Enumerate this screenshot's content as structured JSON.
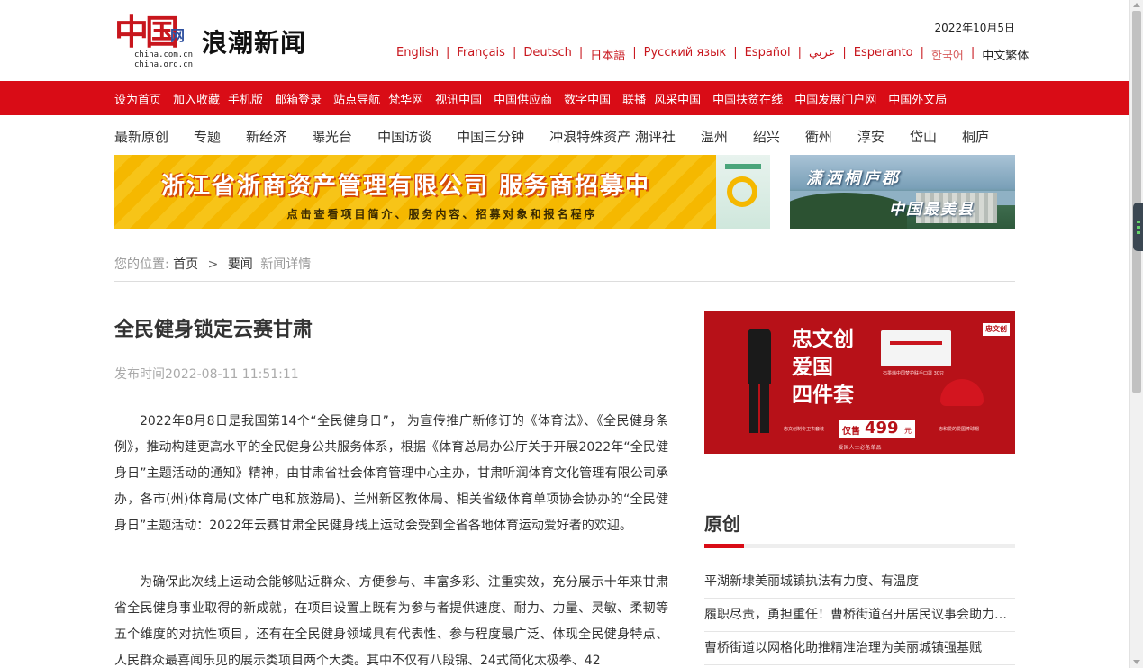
{
  "header": {
    "logo_cn": "中国",
    "logo_wang": "网",
    "logo_domain1": "china.com.cn",
    "logo_domain2": "china.org.cn",
    "site_name": "浪潮新闻",
    "date": "2022年10月5日",
    "languages": [
      "English",
      "Français",
      "Deutsch",
      "日本語",
      "Русский язык",
      "Español",
      "عربي",
      "Esperanto",
      "한국어",
      "中文繁体"
    ],
    "separator": "|"
  },
  "red_nav": [
    "设为首页",
    "加入收藏",
    "手机版",
    "邮箱登录",
    "站点导航",
    "梵华网",
    "视讯中国",
    "中国供应商",
    "数字中国",
    "联播",
    "风采中国",
    "中国扶贫在线",
    "中国发展门户网",
    "中国外文局"
  ],
  "sub_nav": [
    "最新原创",
    "专题",
    "新经济",
    "曝光台",
    "中国访谈",
    "中国三分钟",
    "冲浪特殊资产 潮评社",
    "温州",
    "绍兴",
    "衢州",
    "淳安",
    "岱山",
    "桐庐"
  ],
  "banners": {
    "banner1_title": "浙江省浙商资产管理有限公司 服务商招募中",
    "banner1_sub": "点击查看项目简介、服务内容、招募对象和报名程序",
    "banner2_line1": "潇洒桐庐郡",
    "banner2_line2": "中国最美县"
  },
  "breadcrumb": {
    "label": "您的位置:",
    "home": "首页",
    "sep": ">",
    "section": "要闻",
    "current": "新闻详情"
  },
  "article": {
    "title": "全民健身锁定云赛甘肃",
    "pubtime": "发布时间2022-08-11 11:51:11",
    "paragraphs": [
      "2022年8月8日是我国第14个“全民健身日”， 为宣传推广新修订的《体育法》、《全民健身条例》，推动构建更高水平的全民健身公共服务体系，根据《体育总局办公厅关于开展2022年“全民健身日”主题活动的通知》精神，由甘肃省社会体育管理中心主办，甘肃听润体育文化管理有限公司承办，各市(州)体育局(文体广电和旅游局)、兰州新区教体局、相关省级体育单项协会协办的“全民健身日”主题活动：2022年云赛甘肃全民健身线上运动会受到全省各地体育运动爱好者的欢迎。",
      "为确保此次线上运动会能够贴近群众、方便参与、丰富多彩、注重实效，充分展示十年来甘肃省全民健身事业取得的新成就，在项目设置上既有为参与者提供速度、耐力、力量、灵敏、柔韧等五个维度的对抗性项目，还有在全民健身领域具有代表性、参与程度最广泛、体现全民健身特点、人民群众最喜闻乐见的展示类项目两个大类。其中不仅有八段锦、24式简化太极拳、42"
    ]
  },
  "sidebar": {
    "ad": {
      "title": "忠文创\n爱国\n四件套",
      "logo": "忠文创",
      "price_label": "仅售",
      "price": "499",
      "price_unit": "元",
      "note1": "石墨烯中国梦护肤手口罩 30只",
      "note2": "忠文创制专卫衣套装",
      "note3": "忠和爱的爱国棒球帽",
      "footer": "爱国人士必备单品"
    },
    "section_title": "原创",
    "news": [
      "平湖新埭美丽城镇执法有力度、有温度",
      "履职尽责，勇担重任！曹桥街道召开居民议事会助力美丽城镇建设",
      "曹桥街道以网格化助推精准治理为美丽城镇强基赋"
    ]
  },
  "colors": {
    "brand_red": "#d90c16",
    "lang_red": "#c8161d"
  }
}
